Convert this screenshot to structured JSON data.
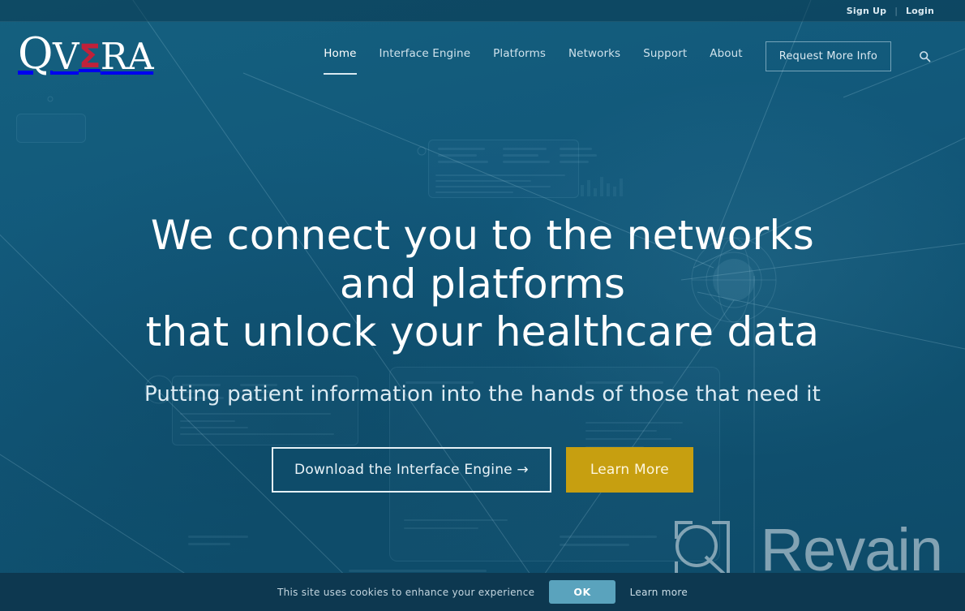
{
  "topbar": {
    "sign_up": "Sign Up",
    "separator": "|",
    "login": "Login"
  },
  "brand": {
    "part1": "Q",
    "part2": "V",
    "sigma": "Σ",
    "part3": "RA",
    "sigma_color": "#c0213a"
  },
  "nav": {
    "items": [
      {
        "label": "Home",
        "active": true
      },
      {
        "label": "Interface Engine",
        "active": false
      },
      {
        "label": "Platforms",
        "active": false
      },
      {
        "label": "Networks",
        "active": false
      },
      {
        "label": "Support",
        "active": false
      },
      {
        "label": "About",
        "active": false
      }
    ],
    "cta_label": "Request More Info",
    "search_icon": "search-icon"
  },
  "hero": {
    "headline_line1": "We connect you to the networks and platforms",
    "headline_line2": "that unlock your healthcare data",
    "subheadline": "Putting patient information into the hands of those that need it",
    "primary_cta": "Download the Interface Engine →",
    "secondary_cta": "Learn More",
    "secondary_cta_color": "#c79f10"
  },
  "watermark": {
    "text": "Revain",
    "logo_icon": "revain-logo-icon"
  },
  "cookie_banner": {
    "message": "This site uses cookies to enhance your experience",
    "ok_label": "OK",
    "learn_more_label": "Learn more",
    "ok_color": "#5aa3bd"
  },
  "theme": {
    "background": "#11587a",
    "topbar_background": "#07344a",
    "cookiebar_background": "#0d3850"
  }
}
